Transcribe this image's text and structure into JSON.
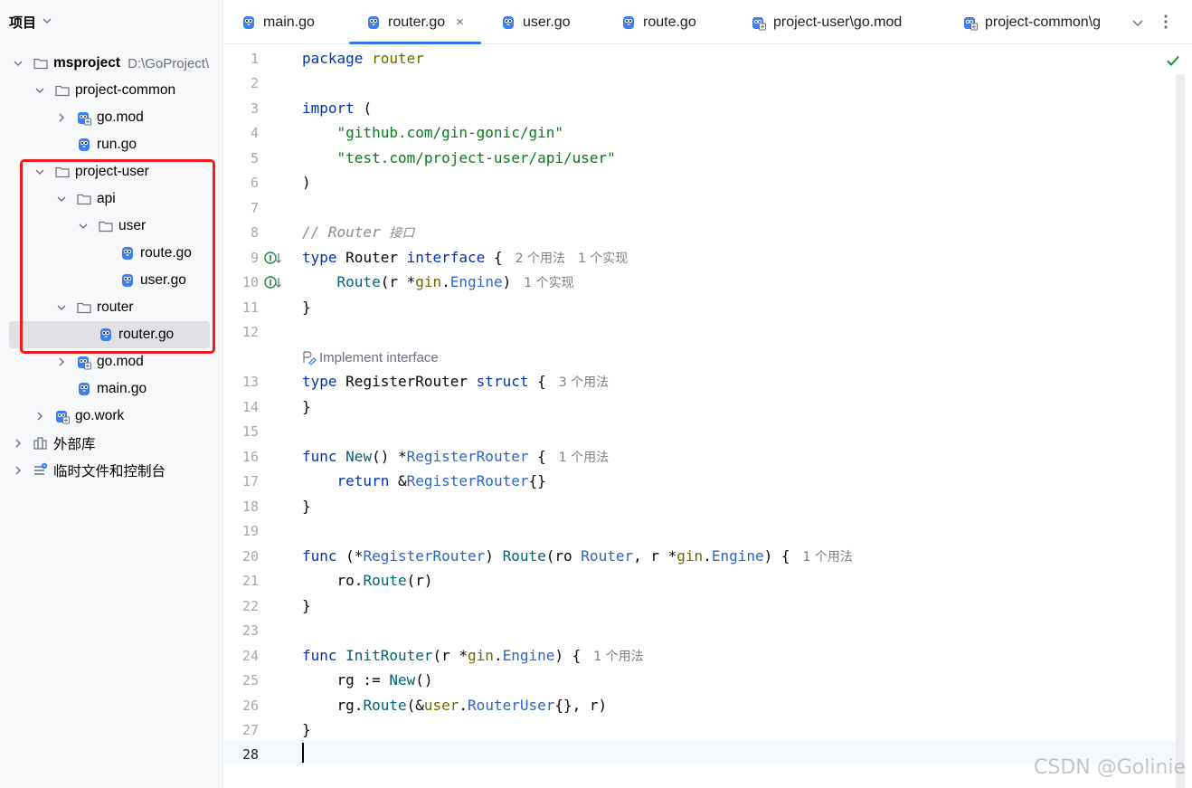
{
  "project_panel": {
    "title": "项目",
    "tree": [
      {
        "label": "msproject",
        "path": "D:\\GoProject\\",
        "kind": "folder",
        "chevron": "down",
        "bold": true
      },
      {
        "label": "project-common",
        "kind": "folder",
        "chevron": "down"
      },
      {
        "label": "go.mod",
        "kind": "gomod",
        "chevron": "right"
      },
      {
        "label": "run.go",
        "kind": "gofile"
      },
      {
        "label": "project-user",
        "kind": "folder",
        "chevron": "down"
      },
      {
        "label": "api",
        "kind": "folder",
        "chevron": "down"
      },
      {
        "label": "user",
        "kind": "folder",
        "chevron": "down"
      },
      {
        "label": "route.go",
        "kind": "gofile"
      },
      {
        "label": "user.go",
        "kind": "gofile"
      },
      {
        "label": "router",
        "kind": "folder",
        "chevron": "down"
      },
      {
        "label": "router.go",
        "kind": "gofile",
        "selected": true
      },
      {
        "label": "go.mod",
        "kind": "gomod",
        "chevron": "right"
      },
      {
        "label": "main.go",
        "kind": "gofile"
      },
      {
        "label": "go.work",
        "kind": "gomod",
        "chevron": "right"
      },
      {
        "label": "外部库",
        "kind": "library",
        "chevron": "right"
      },
      {
        "label": "临时文件和控制台",
        "kind": "scratches",
        "chevron": "right"
      }
    ]
  },
  "tabs": [
    {
      "label": "main.go"
    },
    {
      "label": "router.go",
      "active": true,
      "close": "×"
    },
    {
      "label": "user.go"
    },
    {
      "label": "route.go"
    },
    {
      "label": "project-user\\go.mod"
    },
    {
      "label": "project-common\\g"
    }
  ],
  "editor": {
    "line_numbers": [
      "1",
      "2",
      "3",
      "4",
      "5",
      "6",
      "7",
      "8",
      "9",
      "10",
      "11",
      "12",
      "13",
      "14",
      "15",
      "16",
      "17",
      "18",
      "19",
      "20",
      "21",
      "22",
      "23",
      "24",
      "25",
      "26",
      "27",
      "28"
    ],
    "code": {
      "l1_kw": "package",
      "l1_name": "router",
      "l3_kw": "import",
      "l3_paren": "(",
      "l4_str": "\"github.com/gin-gonic/gin\"",
      "l5_str": "\"test.com/project-user/api/user\"",
      "l6": ")",
      "l8_cmt": "// Router",
      "l8_cmt_cn": "接口",
      "l9_kw": "type",
      "l9_name": "Router",
      "l9_kw2": "interface",
      "l9_brace": "{",
      "l9_hint1": "2 个用法",
      "l9_hint2": "1 个实现",
      "l10_fn": "Route",
      "l10_p1": "(r *",
      "l10_mod": "gin",
      "l10_dot": ".",
      "l10_ty": "Engine",
      "l10_p2": ")",
      "l10_hint": "1 个实现",
      "l11": "}",
      "impl_hint": "Implement interface",
      "l13_kw": "type",
      "l13_name": "RegisterRouter",
      "l13_kw2": "struct",
      "l13_brace": "{",
      "l13_hint": "3 个用法",
      "l14": "}",
      "l16_kw": "func",
      "l16_fn": "New",
      "l16_p": "() *",
      "l16_ty": "RegisterRouter",
      "l16_brace": "{",
      "l16_hint": "1 个用法",
      "l17_kw": "return",
      "l17_amp": "&",
      "l17_ty": "RegisterRouter",
      "l17_br": "{}",
      "l18": "}",
      "l20_kw": "func",
      "l20_p1": "(*",
      "l20_ty1": "RegisterRouter",
      "l20_p2": ")",
      "l20_fn": "Route",
      "l20_p3": "(ro",
      "l20_ty2": "Router",
      "l20_p4": ", r *",
      "l20_mod": "gin",
      "l20_dot": ".",
      "l20_ty3": "Engine",
      "l20_p5": ") {",
      "l20_hint": "1 个用法",
      "l21_a": "ro.",
      "l21_fn": "Route",
      "l21_b": "(r)",
      "l22": "}",
      "l24_kw": "func",
      "l24_fn": "InitRouter",
      "l24_p1": "(r *",
      "l24_mod": "gin",
      "l24_dot": ".",
      "l24_ty": "Engine",
      "l24_p2": ") {",
      "l24_hint": "1 个用法",
      "l25_a": "rg := ",
      "l25_fn": "New",
      "l25_b": "()",
      "l26_a": "rg.",
      "l26_fn": "Route",
      "l26_b": "(&",
      "l26_mod": "user",
      "l26_dot": ".",
      "l26_ty": "RouterUser",
      "l26_c": "{}, r)",
      "l27": "}"
    }
  },
  "watermark": "CSDN @Golinie",
  "colors": {
    "accent": "#3574f0",
    "highlight_box": "#ee1c1c",
    "gopher": "#3d7ef0"
  }
}
